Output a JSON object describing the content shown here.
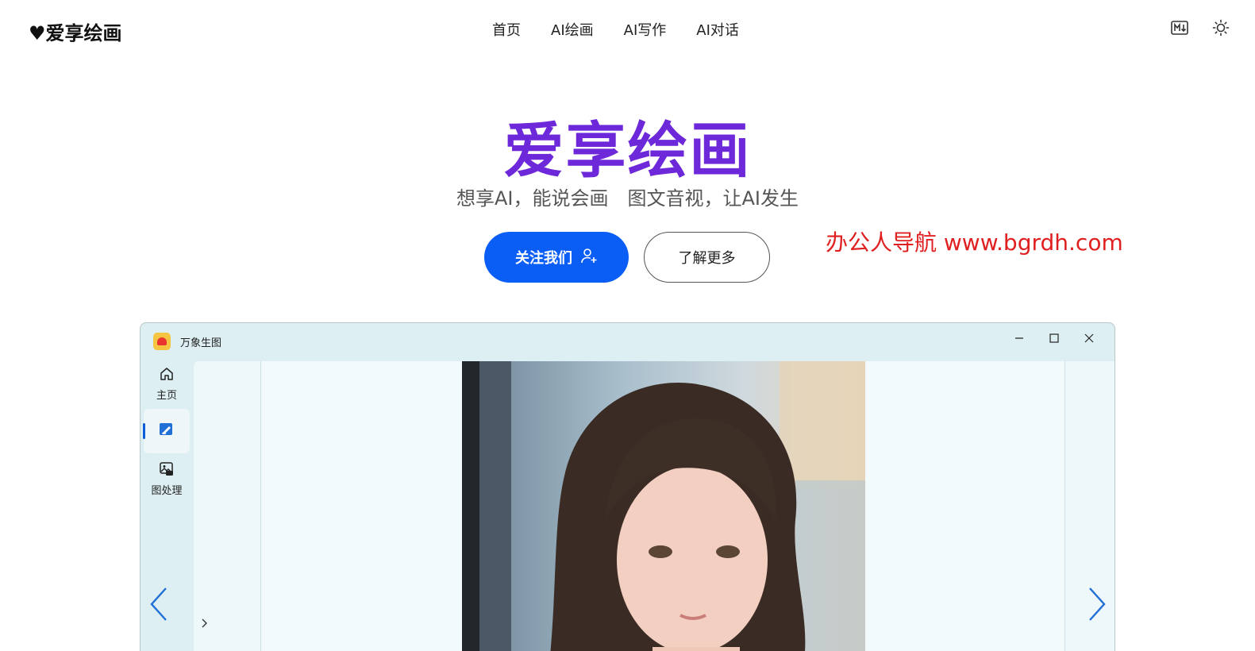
{
  "header": {
    "logo": "♥爱享绘画",
    "nav": [
      "首页",
      "AI绘画",
      "AI写作",
      "AI对话"
    ],
    "icons": [
      "markdown-icon",
      "sun-icon"
    ]
  },
  "hero": {
    "title": "爱享绘画",
    "subtitle": "想享AI，能说会画　图文音视，让AI发生",
    "primary_button": "关注我们",
    "secondary_button": "了解更多",
    "watermark": "办公人导航 www.bgrdh.com",
    "title_color": "#6d28d9",
    "primary_color": "#0b5ef5"
  },
  "app_window": {
    "title": "万象生图",
    "sidebar": [
      {
        "label": "主页",
        "icon": "home-icon"
      },
      {
        "label": "",
        "icon": "paint-edit-icon",
        "active": true
      },
      {
        "label": "图处理",
        "icon": "image-process-icon"
      }
    ],
    "window_controls": [
      "minimize-icon",
      "maximize-icon",
      "close-icon"
    ],
    "accent_color": "#0b5ed8"
  }
}
